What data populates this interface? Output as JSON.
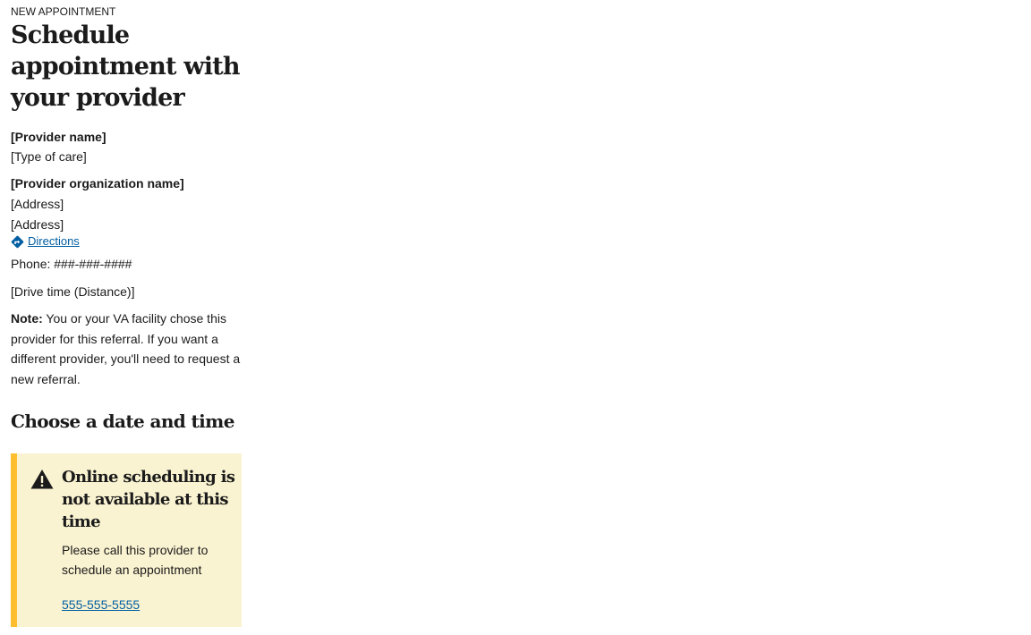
{
  "header": {
    "eyebrow": "NEW APPOINTMENT",
    "title": "Schedule appointment with your provider"
  },
  "provider": {
    "name": "[Provider name]",
    "type_of_care": "[Type of care]",
    "organization": "[Provider organization name]",
    "address_line_1": "[Address]",
    "address_line_2": "[Address]",
    "directions_label": "Directions",
    "directions_icon": "directions-icon",
    "phone": "Phone: ###-###-####",
    "drive_time": "[Drive time (Distance)]"
  },
  "note": {
    "label": "Note:",
    "text": " You or your VA facility chose this provider for this referral. If you want a different provider, you'll need to request a new referral."
  },
  "section": {
    "title": "Choose a date and time"
  },
  "alert": {
    "icon": "warning-icon",
    "heading": "Online scheduling is not available at this time",
    "body": "Please call this provider to schedule an appointment",
    "phone_link": "555-555-5555"
  },
  "colors": {
    "link": "#005ea2",
    "alert_background": "#faf3d1",
    "alert_border": "#ffbe2e",
    "text": "#1b1b1b"
  }
}
